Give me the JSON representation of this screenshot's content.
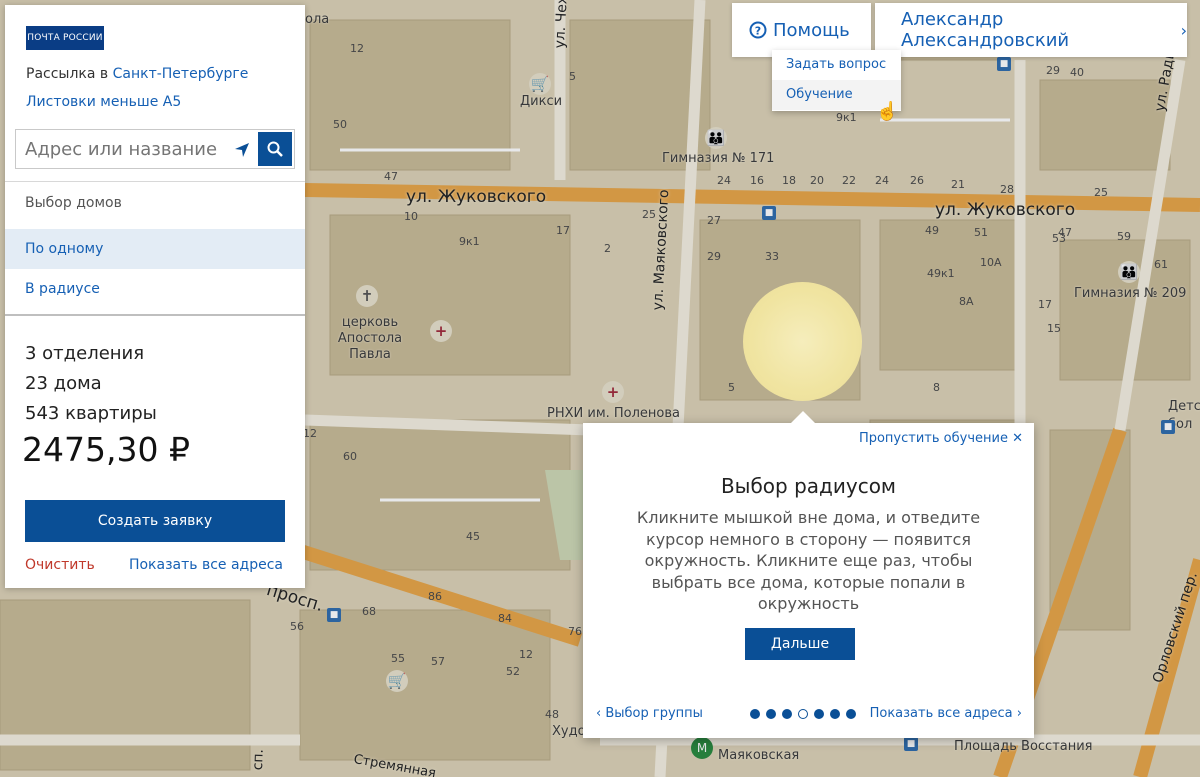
{
  "map": {
    "streets": [
      "ул. Жуковского",
      "ул. Жуковского",
      "ул. Маяковского",
      "ул. Чехова",
      "ул. Радищева",
      "просп.",
      "Орловский пер.",
      "Стремянная",
      "сп."
    ],
    "places": [
      "Дикси",
      "Гимназия № 171",
      "Гимназия № 209",
      "церковь Апостола Павла",
      "РНХИ им. Поленова",
      "Маяковская",
      "Площадь Восстания",
      "Худо",
      "Детс бол",
      "ола"
    ],
    "house_numbers": [
      "5",
      "12",
      "50",
      "47",
      "17",
      "25",
      "9к1",
      "2",
      "10",
      "27",
      "29",
      "33",
      "49",
      "51",
      "47",
      "53",
      "59",
      "61",
      "10А",
      "49к1",
      "8А",
      "17",
      "15",
      "8",
      "5",
      "24",
      "29",
      "40",
      "9к1",
      "20",
      "18",
      "16",
      "24",
      "22",
      "26",
      "21",
      "28",
      "25",
      "12",
      "60",
      "45",
      "86",
      "84",
      "76",
      "56",
      "68",
      "55",
      "57",
      "12",
      "52",
      "48",
      "25"
    ]
  },
  "panel": {
    "logo": "ПОЧТА РОССИИ",
    "mailing_prefix": "Рассылка в",
    "city": "Санкт-Петербурге",
    "format": "Листовки меньше А5",
    "search_placeholder": "Адрес или название",
    "section_label": "Выбор домов",
    "modes": [
      "По одному",
      "В радиусе"
    ],
    "offices": "3 отделения",
    "houses": "23 дома",
    "apartments": "543 квартиры",
    "price": "2475,30 ₽",
    "create_button": "Создать заявку",
    "clear": "Очистить",
    "show_all": "Показать все адреса"
  },
  "header": {
    "help": "Помощь",
    "user": "Александр Александровский",
    "help_menu": [
      "Задать вопрос",
      "Обучение"
    ]
  },
  "tutorial": {
    "skip": "Пропустить обучение",
    "title": "Выбор радиусом",
    "body": "Кликните мышкой вне дома, и отведите курсор немного в сторону — появится окружность. Кликните еще раз, чтобы выбрать все дома, которые попали в окружность",
    "next_button": "Дальше",
    "prev_link": "Выбор группы",
    "next_link": "Показать все адреса",
    "steps_total": 7,
    "step_current": 4
  }
}
